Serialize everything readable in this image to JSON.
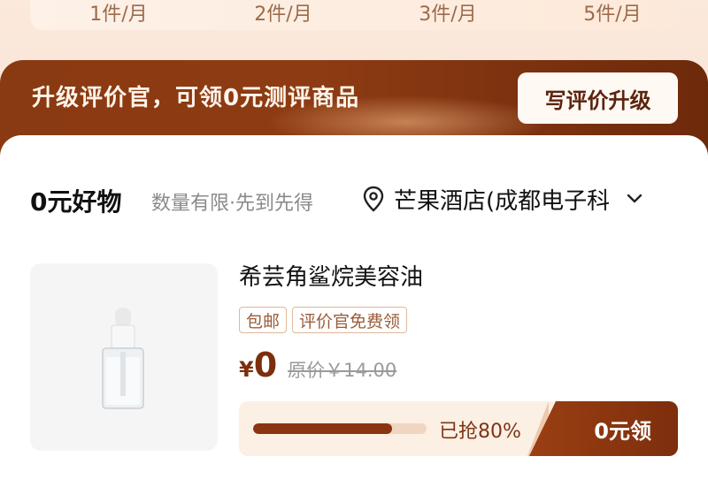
{
  "stats": {
    "items": [
      "1件/月",
      "2件/月",
      "3件/月",
      "5件/月"
    ]
  },
  "banner": {
    "text": "升级评价官，可领0元测评商品",
    "button_label": "写评价升级"
  },
  "section": {
    "title": "0元好物",
    "subtitle": "数量有限·先到先得",
    "location": "芒果酒店(成都电子科",
    "location_icon": "map-pin-icon",
    "dropdown_icon": "chevron-down-icon"
  },
  "product": {
    "name": "希芸角鲨烷美容油",
    "tags": [
      "包邮",
      "评价官免费领"
    ],
    "price_symbol": "¥",
    "price": "0",
    "original_price": "原价￥14.00",
    "progress_percent": 80,
    "progress_text": "已抢80%",
    "claim_label": "0元领"
  }
}
